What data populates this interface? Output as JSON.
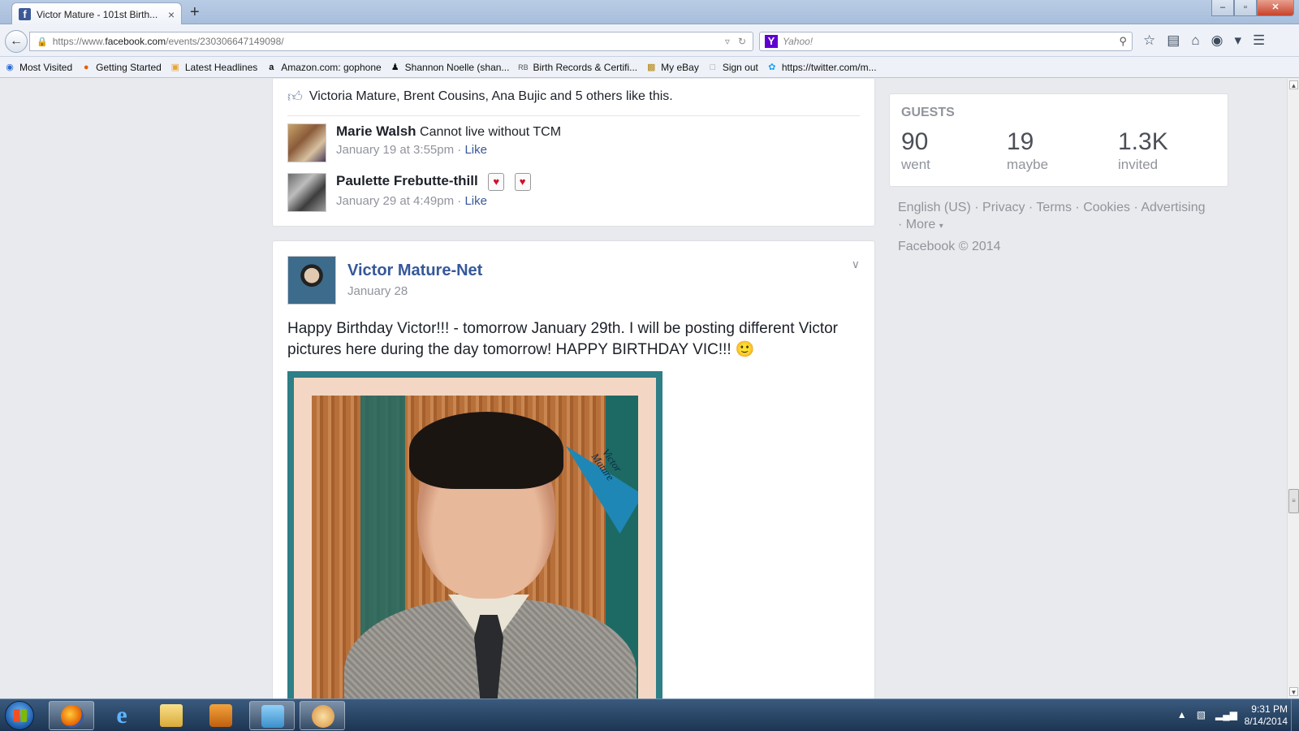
{
  "browser": {
    "tab_title": "Victor Mature - 101st Birth...",
    "tab_close": "×",
    "new_tab": "+",
    "url_prefix": "https://www.",
    "url_domain": "facebook.com",
    "url_path": "/events/230306647149098/",
    "search_placeholder": "Yahoo!",
    "win_min": "–",
    "win_max": "▫",
    "win_close": "✕"
  },
  "bookmarks": [
    {
      "label": "Most Visited",
      "icon": "globe-icon"
    },
    {
      "label": "Getting Started",
      "icon": "firefox-icon"
    },
    {
      "label": "Latest Headlines",
      "icon": "rss-icon"
    },
    {
      "label": "Amazon.com: gophone",
      "icon": "amazon-icon"
    },
    {
      "label": "Shannon Noelle (shan...",
      "icon": "people-icon"
    },
    {
      "label": "Birth Records & Certifi...",
      "icon": "rb-icon"
    },
    {
      "label": "My eBay",
      "icon": "ebay-icon"
    },
    {
      "label": "Sign out",
      "icon": "page-icon"
    },
    {
      "label": "https://twitter.com/m...",
      "icon": "twitter-icon"
    }
  ],
  "likes_card": {
    "likes_text": "Victoria Mature, Brent Cousins, Ana Bujic and 5 others like this.",
    "comments": [
      {
        "name": "Marie Walsh",
        "text": "Cannot live without TCM",
        "time": "January 19 at 3:55pm",
        "action": "Like"
      },
      {
        "name": "Paulette Frebutte-thill",
        "text": "",
        "time": "January 29 at 4:49pm",
        "action": "Like"
      }
    ],
    "separator": "·"
  },
  "post": {
    "author": "Victor Mature-Net",
    "date": "January 28",
    "text": "Happy Birthday Victor!!! - tomorrow January 29th. I will be posting different Victor pictures here during the day tomorrow! HAPPY BIRTHDAY VIC!!! 🙂",
    "photo_pennant": "Victor Mature"
  },
  "guests": {
    "title": "GUESTS",
    "stats": [
      {
        "value": "90",
        "label": "went"
      },
      {
        "value": "19",
        "label": "maybe"
      },
      {
        "value": "1.3K",
        "label": "invited"
      }
    ]
  },
  "footer": {
    "links": [
      "English (US)",
      "Privacy",
      "Terms",
      "Cookies",
      "Advertising",
      "More"
    ],
    "copyright": "Facebook © 2014"
  },
  "taskbar": {
    "time": "9:31 PM",
    "date": "8/14/2014"
  },
  "colors": {
    "facebook_blue": "#3b5998",
    "link_blue": "#365899",
    "page_bg": "#e9eaed"
  }
}
